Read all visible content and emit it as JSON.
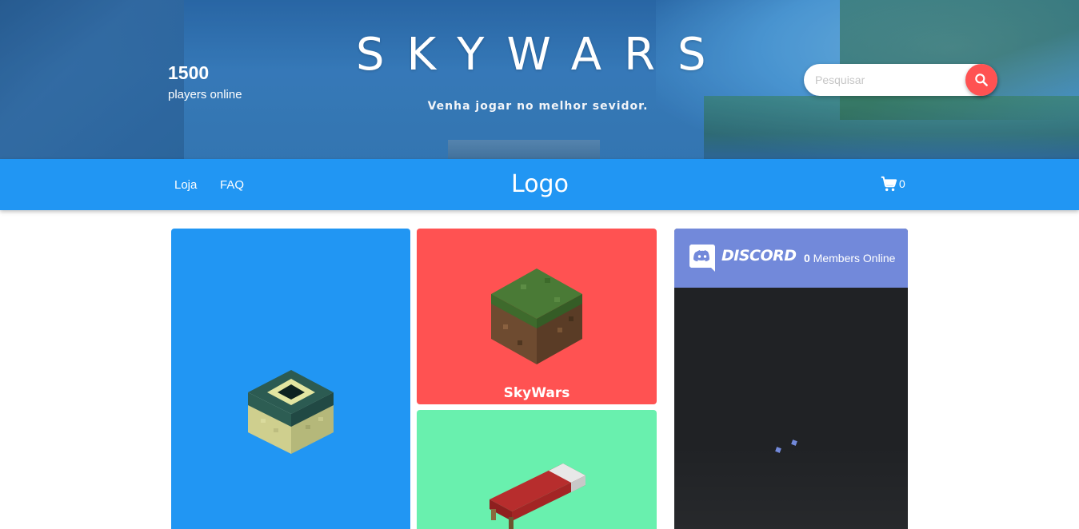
{
  "header": {
    "players_count": "1500",
    "players_label": "players online",
    "title": "SKYWARS",
    "tagline": "Venha jogar no melhor sevidor.",
    "search_placeholder": "Pesquisar"
  },
  "nav": {
    "links": [
      "Loja",
      "FAQ"
    ],
    "logo": "Logo",
    "cart_count": "0"
  },
  "cards": [
    {
      "name": "end-portal-card",
      "color": "#2196f3"
    },
    {
      "name": "skywars-card",
      "label": "SkyWars",
      "color": "#ff5252"
    },
    {
      "name": "bedwars-card",
      "color": "#69f0ae"
    }
  ],
  "discord": {
    "brand": "DISCORD",
    "members_count": "0",
    "members_label": " Members Online",
    "header_color": "#7289da",
    "body_color": "#202225"
  },
  "icons": [
    "search-icon",
    "cart-icon",
    "discord-logo-icon"
  ],
  "colors": {
    "primary": "#2196f3",
    "accent": "#ff5252",
    "green": "#69f0ae"
  }
}
